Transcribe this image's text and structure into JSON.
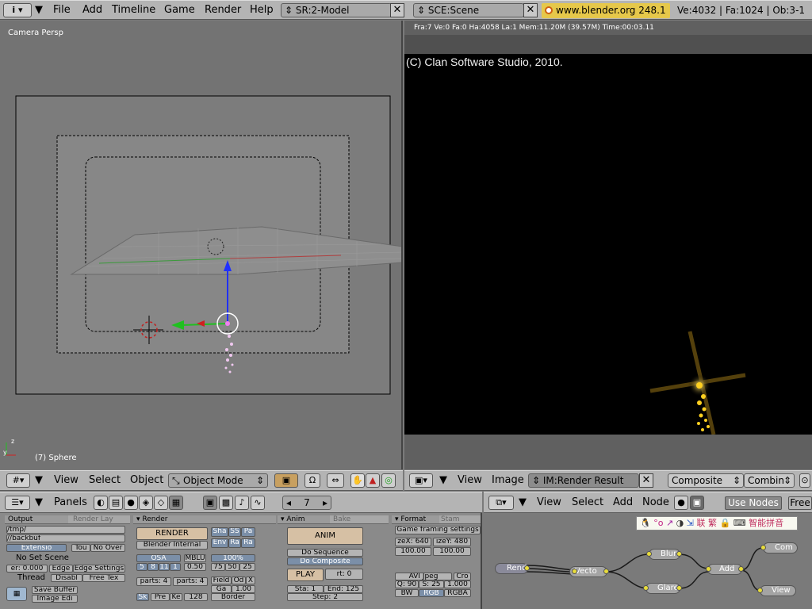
{
  "topbar": {
    "info_icon": "i",
    "menu": [
      "File",
      "Add",
      "Timeline",
      "Game",
      "Render",
      "Help"
    ],
    "screen": "SR:2-Model",
    "scene": "SCE:Scene",
    "url": "www.blender.org 248.1",
    "stats": "Ve:4032 | Fa:1024 | Ob:3-1"
  },
  "viewport": {
    "label": "Camera Persp",
    "object_label": "(7) Sphere",
    "menu": [
      "View",
      "Select",
      "Object"
    ],
    "mode": "Object Mode"
  },
  "render": {
    "status": "Fra:7  Ve:0 Fa:0 Ha:4058 La:1 Mem:11.20M (39.57M) Time:00:03.11",
    "copyright": "(C) Clan Software Studio, 2010."
  },
  "image_editor": {
    "menu": [
      "View",
      "Image"
    ],
    "image_name": "IM:Render Result",
    "layer": "Composite",
    "pass": "Combin"
  },
  "buttons": {
    "panels_label": "Panels",
    "frame": "7",
    "output": {
      "tab": "Output",
      "tab2": "Render Lay",
      "path1": "/tmp/",
      "path2": "//backbuf",
      "extensio": "Extensio",
      "tou": "Tou",
      "no_over": "No Over",
      "no_set_scene": "No Set Scene",
      "ear": "er: 0.000",
      "edge": "Edge",
      "edge_settings": "Edge Settings",
      "thread": "Thread",
      "disabl": "Disabl",
      "free_tex": "Free Tex",
      "save_buffer": "Save Buffer",
      "image_ed": "Image Edi"
    },
    "render_panel": {
      "tab": "Render",
      "render_btn": "RENDER",
      "engine": "Blender Internal",
      "sha": "Sha",
      "ss": "SS",
      "pa": "Pa",
      "env": "Env",
      "ra": "Ra",
      "ra2": "Ra",
      "osa": "OSA",
      "mblu": "MBLU",
      "pct": "100%",
      "osa_vals": [
        "5",
        "8",
        "11",
        "1"
      ],
      "mblu_val": "0.50",
      "pct_vals": [
        "75",
        "50",
        "25"
      ],
      "parts1": "parts: 4",
      "parts2": "parts: 4",
      "field": "Field",
      "od": "Od",
      "x": "X",
      "ga": "Ga",
      "ga_val": "1.00",
      "sk": "Sk",
      "pre": "Pre",
      "ke": "Ke",
      "size128": "128",
      "border": "Border"
    },
    "anim_panel": {
      "tab": "Anim",
      "tab2": "Bake",
      "anim_btn": "ANIM",
      "do_sequence": "Do Sequence",
      "do_composite": "Do Composite",
      "play": "PLAY",
      "rt": "rt: 0",
      "sta": "Sta: 1",
      "end": "End: 125",
      "step": "Step: 2"
    },
    "format_panel": {
      "tab": "Format",
      "tab2": "Stam",
      "game_framing": "Game framing settings",
      "sizex": "zeX: 640",
      "sizey": "izeY: 480",
      "aspx": "100.00",
      "aspy": "100.00",
      "codec": "AVI Jpeg",
      "crop": "Cro",
      "q": "Q: 90",
      "fps": "S: 25",
      "fps_div": "1.000",
      "bw": "BW",
      "rgb": "RGB",
      "rgba": "RGBA"
    }
  },
  "node_editor": {
    "menu": [
      "View",
      "Select",
      "Add",
      "Node"
    ],
    "use_nodes": "Use Nodes",
    "free": "Free",
    "ime_text": "联 繁 ",
    "ime_text2": "智能拼音",
    "nodes": {
      "rend": "Rend",
      "vector": "Vecto",
      "blur": "Blur",
      "glare": "Glare",
      "add": "Add",
      "comp": "Com",
      "view": "View"
    }
  },
  "colors": {
    "header": "#b4b4b4",
    "viewport_bg": "#737373",
    "render_bg": "#000000",
    "url_bg": "#e6c84a",
    "select_orange": "#f0a030"
  }
}
